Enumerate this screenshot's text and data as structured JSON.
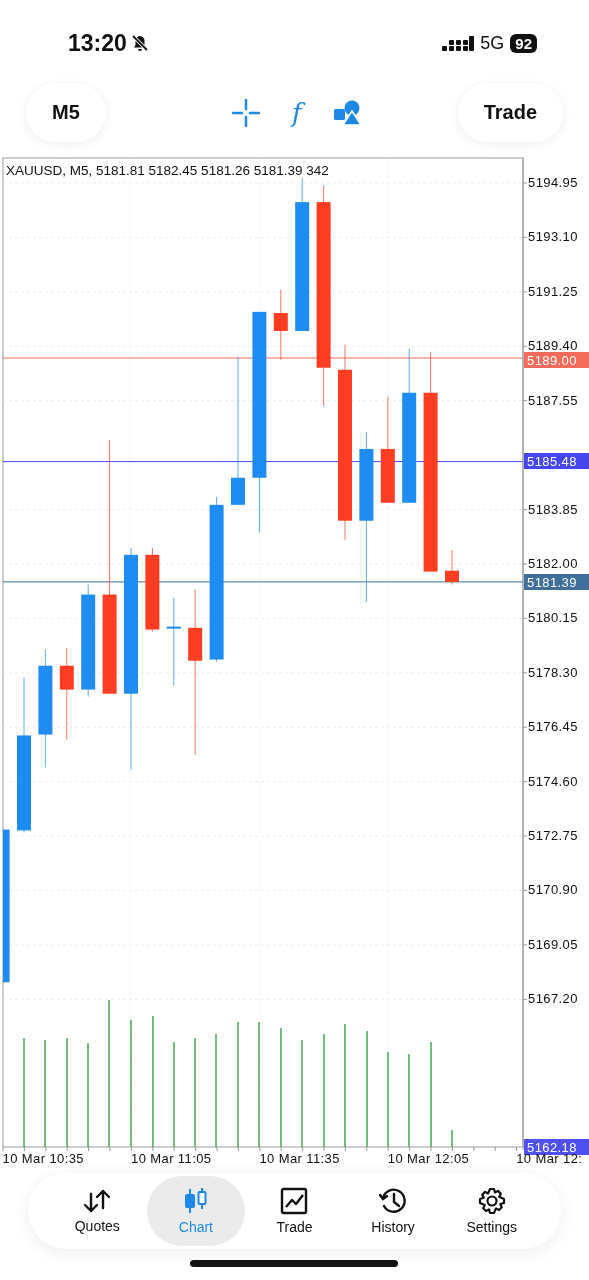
{
  "status_bar": {
    "time": "13:20",
    "network": "5G",
    "battery": "92"
  },
  "toolbar": {
    "timeframe": "M5",
    "function_glyph": "f",
    "trade": "Trade"
  },
  "chart": {
    "header": "XAUUSD, M5, 5181.81 5182.45 5181.26 5181.39 342",
    "price_tags": [
      {
        "label": "5189.00",
        "color": "#f26b5b"
      },
      {
        "label": "5185.48",
        "color": "#4646ee"
      },
      {
        "label": "5181.39",
        "color": "#3f6f9a"
      },
      {
        "label": "5162.18",
        "color": "#5050f0"
      }
    ],
    "chart_data": {
      "type": "candlestick",
      "categories": [
        null,
        null,
        null,
        null,
        null,
        null,
        null,
        null,
        null,
        null,
        null,
        null,
        null,
        null,
        null,
        null,
        null,
        null,
        null,
        null,
        null,
        null
      ],
      "ylim": [
        5162.18,
        5195.8
      ],
      "grid": true,
      "ref_lines": [
        {
          "axis": "y",
          "value": 5189.0,
          "color": "#f26b5b"
        },
        {
          "axis": "y",
          "value": 5185.48,
          "color": "#4646ee"
        },
        {
          "axis": "y",
          "value": 5181.39,
          "color": "#3f6f9a"
        }
      ],
      "ohlc": [
        [
          5167.78,
          5172.97,
          5167.78,
          5172.97
        ],
        [
          5172.94,
          5178.14,
          5172.87,
          5176.17
        ],
        [
          5176.2,
          5179.09,
          5175.08,
          5178.54
        ],
        [
          5178.54,
          5179.15,
          5176.03,
          5177.73
        ],
        [
          5177.73,
          5181.3,
          5177.49,
          5180.96
        ],
        [
          5180.96,
          5186.22,
          5177.59,
          5177.59
        ],
        [
          5177.59,
          5182.55,
          5175.01,
          5182.31
        ],
        [
          5182.31,
          5182.55,
          5179.7,
          5179.77
        ],
        [
          5179.8,
          5180.85,
          5177.86,
          5179.87
        ],
        [
          5179.83,
          5181.13,
          5175.52,
          5178.71
        ],
        [
          5178.75,
          5184.28,
          5178.68,
          5184.01
        ],
        [
          5184.01,
          5189.04,
          5184.01,
          5184.93
        ],
        [
          5184.93,
          5190.57,
          5183.06,
          5190.57
        ],
        [
          5190.53,
          5191.32,
          5188.94,
          5189.92
        ],
        [
          5189.92,
          5195.12,
          5189.92,
          5194.3
        ],
        [
          5194.3,
          5194.85,
          5187.38,
          5188.67
        ],
        [
          5188.6,
          5189.45,
          5182.82,
          5183.47
        ],
        [
          5183.47,
          5186.49,
          5180.72,
          5185.91
        ],
        [
          5185.91,
          5187.68,
          5184.08,
          5184.08
        ],
        [
          5184.08,
          5189.31,
          5184.08,
          5187.82
        ],
        [
          5187.82,
          5189.21,
          5181.74,
          5181.74
        ],
        [
          5181.77,
          5182.48,
          5181.3,
          5181.39
        ]
      ],
      "yticks": [
        {
          "value": 5194.95,
          "label": "5194.95"
        },
        {
          "value": 5193.1,
          "label": "5193.10"
        },
        {
          "value": 5191.25,
          "label": "5191.25"
        },
        {
          "value": 5189.4,
          "label": "5189.40"
        },
        {
          "value": 5187.55,
          "label": "5187.55"
        },
        {
          "value": 5183.85,
          "label": "5183.85"
        },
        {
          "value": 5182,
          "label": "5182.00"
        },
        {
          "value": 5180.15,
          "label": "5180.15"
        },
        {
          "value": 5178.3,
          "label": "5178.30"
        },
        {
          "value": 5176.45,
          "label": "5176.45"
        },
        {
          "value": 5174.6,
          "label": "5174.60"
        },
        {
          "value": 5172.75,
          "label": "5172.75"
        },
        {
          "value": 5170.9,
          "label": "5170.90"
        },
        {
          "value": 5169.05,
          "label": "5169.05"
        },
        {
          "value": 5167.2,
          "label": "5167.20"
        }
      ]
    },
    "time_labels": [
      "10 Mar 10:35",
      "10 Mar 11:05",
      "10 Mar 11:35",
      "10 Mar 12:05",
      "10 Mar 12:"
    ]
  },
  "nav": [
    {
      "label": "Quotes",
      "selected": false
    },
    {
      "label": "Chart",
      "selected": true
    },
    {
      "label": "Trade",
      "selected": false
    },
    {
      "label": "History",
      "selected": false
    },
    {
      "label": "Settings",
      "selected": false
    }
  ]
}
